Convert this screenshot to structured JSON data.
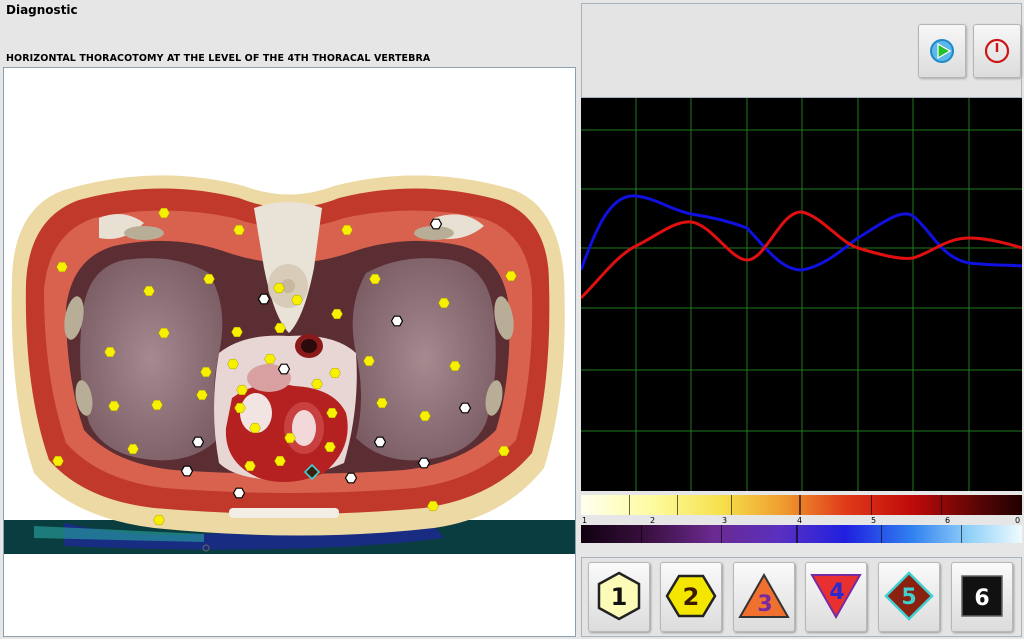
{
  "window": {
    "title": "Diagnostic"
  },
  "scan": {
    "heading": "HORIZONTAL THORACOTOMY AT THE LEVEL OF THE 4TH THORACAL VERTEBRA"
  },
  "toolbar": {
    "play_icon": "play-icon",
    "power_icon": "power-icon"
  },
  "spectrum": {
    "scale_labels": [
      "1",
      "2",
      "3",
      "4",
      "5",
      "6",
      "0"
    ]
  },
  "markers": [
    {
      "label": "1",
      "shape": "hexagon",
      "fill": "#fdfbb8",
      "text_color": "#111111"
    },
    {
      "label": "2",
      "shape": "hexagon",
      "fill": "#f5e600",
      "text_color": "#3a1a00"
    },
    {
      "label": "3",
      "shape": "triangle-up",
      "fill": "#f07030",
      "text_color": "#7a2aa0"
    },
    {
      "label": "4",
      "shape": "triangle-down",
      "fill": "#e83030",
      "text_color": "#2a2ad0"
    },
    {
      "label": "5",
      "shape": "diamond",
      "fill": "#8a2010",
      "text_color": "#40d0d0"
    },
    {
      "label": "6",
      "shape": "square",
      "fill": "#111111",
      "text_color": "#ffffff"
    }
  ],
  "colors": {
    "graph_background": "#000000",
    "grid": "#1f7a1f",
    "curve_blue": "#1010e0",
    "curve_red": "#e01010"
  }
}
